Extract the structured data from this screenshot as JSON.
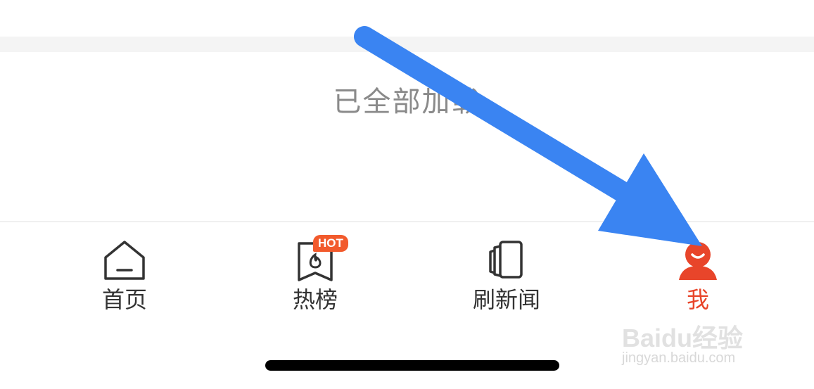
{
  "status": {
    "loaded_text": "已全部加载"
  },
  "tab_bar": {
    "tabs": [
      {
        "label": "首页",
        "icon": "home-icon",
        "active": false
      },
      {
        "label": "热榜",
        "icon": "hot-list-icon",
        "badge": "HOT",
        "active": false
      },
      {
        "label": "刷新闻",
        "icon": "news-cards-icon",
        "active": false
      },
      {
        "label": "我",
        "icon": "profile-icon",
        "active": true
      }
    ]
  },
  "colors": {
    "accent": "#e8452a",
    "badge": "#f25a2c",
    "annotation_arrow": "#3a84f2"
  },
  "watermark": {
    "main": "Baidu经验",
    "sub": "jingyan.baidu.com"
  }
}
